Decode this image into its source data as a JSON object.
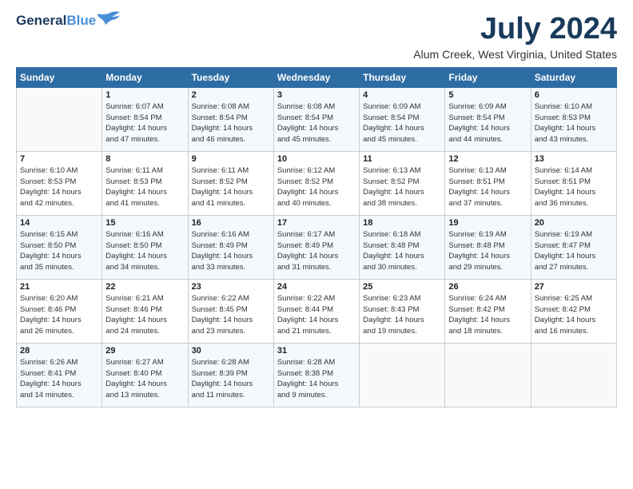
{
  "logo": {
    "line1": "General",
    "line2": "Blue"
  },
  "title": "July 2024",
  "location": "Alum Creek, West Virginia, United States",
  "weekdays": [
    "Sunday",
    "Monday",
    "Tuesday",
    "Wednesday",
    "Thursday",
    "Friday",
    "Saturday"
  ],
  "weeks": [
    [
      {
        "day": "",
        "info": ""
      },
      {
        "day": "1",
        "info": "Sunrise: 6:07 AM\nSunset: 8:54 PM\nDaylight: 14 hours\nand 47 minutes."
      },
      {
        "day": "2",
        "info": "Sunrise: 6:08 AM\nSunset: 8:54 PM\nDaylight: 14 hours\nand 46 minutes."
      },
      {
        "day": "3",
        "info": "Sunrise: 6:08 AM\nSunset: 8:54 PM\nDaylight: 14 hours\nand 45 minutes."
      },
      {
        "day": "4",
        "info": "Sunrise: 6:09 AM\nSunset: 8:54 PM\nDaylight: 14 hours\nand 45 minutes."
      },
      {
        "day": "5",
        "info": "Sunrise: 6:09 AM\nSunset: 8:54 PM\nDaylight: 14 hours\nand 44 minutes."
      },
      {
        "day": "6",
        "info": "Sunrise: 6:10 AM\nSunset: 8:53 PM\nDaylight: 14 hours\nand 43 minutes."
      }
    ],
    [
      {
        "day": "7",
        "info": "Sunrise: 6:10 AM\nSunset: 8:53 PM\nDaylight: 14 hours\nand 42 minutes."
      },
      {
        "day": "8",
        "info": "Sunrise: 6:11 AM\nSunset: 8:53 PM\nDaylight: 14 hours\nand 41 minutes."
      },
      {
        "day": "9",
        "info": "Sunrise: 6:11 AM\nSunset: 8:52 PM\nDaylight: 14 hours\nand 41 minutes."
      },
      {
        "day": "10",
        "info": "Sunrise: 6:12 AM\nSunset: 8:52 PM\nDaylight: 14 hours\nand 40 minutes."
      },
      {
        "day": "11",
        "info": "Sunrise: 6:13 AM\nSunset: 8:52 PM\nDaylight: 14 hours\nand 38 minutes."
      },
      {
        "day": "12",
        "info": "Sunrise: 6:13 AM\nSunset: 8:51 PM\nDaylight: 14 hours\nand 37 minutes."
      },
      {
        "day": "13",
        "info": "Sunrise: 6:14 AM\nSunset: 8:51 PM\nDaylight: 14 hours\nand 36 minutes."
      }
    ],
    [
      {
        "day": "14",
        "info": "Sunrise: 6:15 AM\nSunset: 8:50 PM\nDaylight: 14 hours\nand 35 minutes."
      },
      {
        "day": "15",
        "info": "Sunrise: 6:16 AM\nSunset: 8:50 PM\nDaylight: 14 hours\nand 34 minutes."
      },
      {
        "day": "16",
        "info": "Sunrise: 6:16 AM\nSunset: 8:49 PM\nDaylight: 14 hours\nand 33 minutes."
      },
      {
        "day": "17",
        "info": "Sunrise: 6:17 AM\nSunset: 8:49 PM\nDaylight: 14 hours\nand 31 minutes."
      },
      {
        "day": "18",
        "info": "Sunrise: 6:18 AM\nSunset: 8:48 PM\nDaylight: 14 hours\nand 30 minutes."
      },
      {
        "day": "19",
        "info": "Sunrise: 6:19 AM\nSunset: 8:48 PM\nDaylight: 14 hours\nand 29 minutes."
      },
      {
        "day": "20",
        "info": "Sunrise: 6:19 AM\nSunset: 8:47 PM\nDaylight: 14 hours\nand 27 minutes."
      }
    ],
    [
      {
        "day": "21",
        "info": "Sunrise: 6:20 AM\nSunset: 8:46 PM\nDaylight: 14 hours\nand 26 minutes."
      },
      {
        "day": "22",
        "info": "Sunrise: 6:21 AM\nSunset: 8:46 PM\nDaylight: 14 hours\nand 24 minutes."
      },
      {
        "day": "23",
        "info": "Sunrise: 6:22 AM\nSunset: 8:45 PM\nDaylight: 14 hours\nand 23 minutes."
      },
      {
        "day": "24",
        "info": "Sunrise: 6:22 AM\nSunset: 8:44 PM\nDaylight: 14 hours\nand 21 minutes."
      },
      {
        "day": "25",
        "info": "Sunrise: 6:23 AM\nSunset: 8:43 PM\nDaylight: 14 hours\nand 19 minutes."
      },
      {
        "day": "26",
        "info": "Sunrise: 6:24 AM\nSunset: 8:42 PM\nDaylight: 14 hours\nand 18 minutes."
      },
      {
        "day": "27",
        "info": "Sunrise: 6:25 AM\nSunset: 8:42 PM\nDaylight: 14 hours\nand 16 minutes."
      }
    ],
    [
      {
        "day": "28",
        "info": "Sunrise: 6:26 AM\nSunset: 8:41 PM\nDaylight: 14 hours\nand 14 minutes."
      },
      {
        "day": "29",
        "info": "Sunrise: 6:27 AM\nSunset: 8:40 PM\nDaylight: 14 hours\nand 13 minutes."
      },
      {
        "day": "30",
        "info": "Sunrise: 6:28 AM\nSunset: 8:39 PM\nDaylight: 14 hours\nand 11 minutes."
      },
      {
        "day": "31",
        "info": "Sunrise: 6:28 AM\nSunset: 8:38 PM\nDaylight: 14 hours\nand 9 minutes."
      },
      {
        "day": "",
        "info": ""
      },
      {
        "day": "",
        "info": ""
      },
      {
        "day": "",
        "info": ""
      }
    ]
  ]
}
